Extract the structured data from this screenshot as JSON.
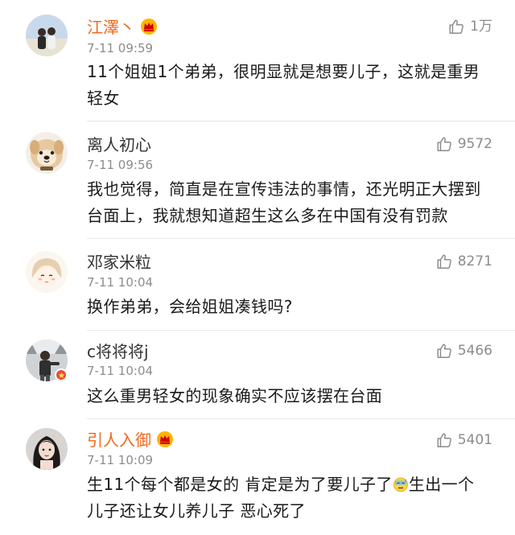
{
  "comments": [
    {
      "user": "江澤丶",
      "time": "7-11 09:59",
      "likes": "1万",
      "text": "11个姐姐1个弟弟，很明显就是想要儿子，这就是重男轻女",
      "name_color": "#f2691b",
      "vip_crown": true
    },
    {
      "user": "离人初心",
      "time": "7-11 09:56",
      "likes": "9572",
      "text": "我也觉得，简直是在宣传违法的事情，还光明正大摆到台面上，我就想知道超生这么多在中国有没有罚款",
      "name_color": "#333333",
      "vip_crown": false
    },
    {
      "user": "邓家米粒",
      "time": "7-11 10:04",
      "likes": "8271",
      "text": "换作弟弟，会给姐姐凑钱吗?",
      "name_color": "#333333",
      "vip_crown": false
    },
    {
      "user": "c将将将j",
      "time": "7-11 10:04",
      "likes": "5466",
      "text": "这么重男轻女的现象确实不应该摆在台面",
      "name_color": "#333333",
      "vip_crown": false,
      "verified_badge": true
    },
    {
      "user": "引人入御",
      "time": "7-11 10:09",
      "likes": "5401",
      "text_part1": "生11个每个都是女的 肯定是为了要儿子了",
      "emoji": "sweat-emoji",
      "text_part2": "生出一个儿子还让女儿养儿子 恶心死了",
      "name_color": "#f2691b",
      "vip_crown": true
    }
  ],
  "icons": {
    "like": "thumbs-up-icon",
    "crown": "vip-crown-icon",
    "badge": "verified-badge-icon"
  }
}
